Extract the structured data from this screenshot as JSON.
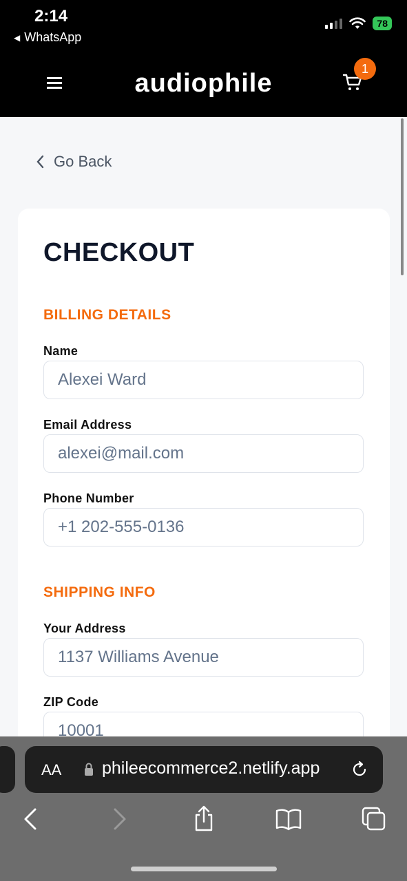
{
  "status_bar": {
    "time": "2:14",
    "back_app": "WhatsApp",
    "battery": "78"
  },
  "header": {
    "brand": "audiophile",
    "cart_count": "1",
    "icons": [
      "hamburger-icon",
      "cart-icon"
    ]
  },
  "nav": {
    "go_back": "Go Back"
  },
  "checkout": {
    "title": "CHECKOUT",
    "billing": {
      "title": "BILLING DETAILS",
      "name_label": "Name",
      "name_placeholder": "Alexei Ward",
      "email_label": "Email Address",
      "email_placeholder": "alexei@mail.com",
      "phone_label": "Phone Number",
      "phone_placeholder": "+1 202-555-0136"
    },
    "shipping": {
      "title": "SHIPPING INFO",
      "address_label": "Your Address",
      "address_placeholder": "1137 Williams Avenue",
      "zip_label": "ZIP Code",
      "zip_placeholder": "10001"
    }
  },
  "browser": {
    "aa_label": "AA",
    "url": "philеecommerce2.netlify.app"
  },
  "colors": {
    "accent": "#f46b0e",
    "header_bg": "#000000",
    "page_bg": "#f6f7f9",
    "battery": "#34c759"
  }
}
